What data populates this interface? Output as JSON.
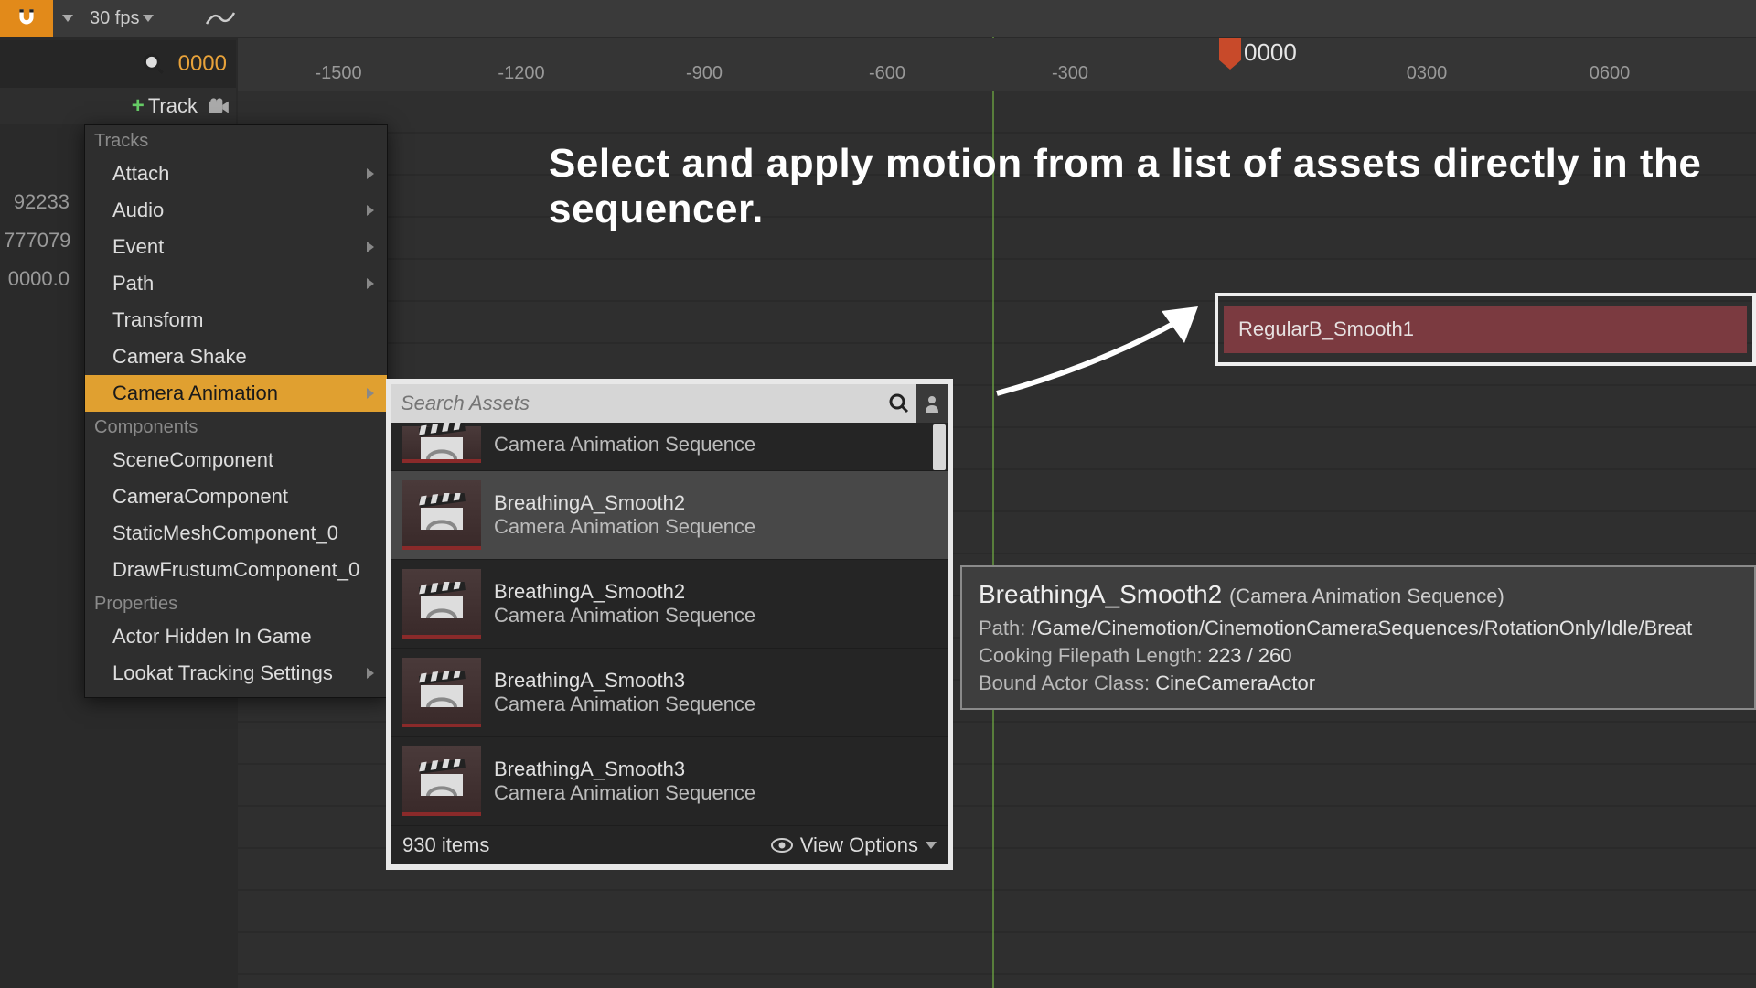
{
  "toolbar": {
    "fps_label": "30 fps"
  },
  "search_row": {
    "frame_label": "0000"
  },
  "track_row": {
    "label": "Track"
  },
  "playhead": {
    "timecode": "0000",
    "ticks": [
      "-1500",
      "-1200",
      "-900",
      "-600",
      "-300",
      "0300",
      "0600"
    ]
  },
  "left_scale": [
    "92233",
    "777079",
    "0000.0"
  ],
  "headline": "Select and apply motion from a list of assets directly in the sequencer.",
  "clip": {
    "name": "RegularB_Smooth1"
  },
  "ctx": {
    "tracks_header": "Tracks",
    "tracks": [
      {
        "label": "Attach",
        "sub": true
      },
      {
        "label": "Audio",
        "sub": true
      },
      {
        "label": "Event",
        "sub": true
      },
      {
        "label": "Path",
        "sub": true
      },
      {
        "label": "Transform",
        "sub": false
      },
      {
        "label": "Camera Shake",
        "sub": false
      },
      {
        "label": "Camera Animation",
        "sub": true,
        "hl": true
      }
    ],
    "components_header": "Components",
    "components": [
      {
        "label": "SceneComponent"
      },
      {
        "label": "CameraComponent"
      },
      {
        "label": "StaticMeshComponent_0"
      },
      {
        "label": "DrawFrustumComponent_0"
      }
    ],
    "properties_header": "Properties",
    "properties": [
      {
        "label": "Actor Hidden In Game",
        "sub": false
      },
      {
        "label": "Lookat Tracking Settings",
        "sub": true
      }
    ]
  },
  "assets": {
    "search_placeholder": "Search Assets",
    "type_label": "Camera Animation Sequence",
    "items": [
      {
        "name": "",
        "first": true
      },
      {
        "name": "BreathingA_Smooth2",
        "hover": true
      },
      {
        "name": "BreathingA_Smooth2"
      },
      {
        "name": "BreathingA_Smooth3"
      },
      {
        "name": "BreathingA_Smooth3"
      }
    ],
    "count": "930 items",
    "view_options": "View Options"
  },
  "tooltip": {
    "title": "BreathingA_Smooth2",
    "subtitle": "(Camera Animation Sequence)",
    "path_label": "Path:",
    "path_value": "/Game/Cinemotion/CinemotionCameraSequences/RotationOnly/Idle/Breat",
    "cook_label": "Cooking Filepath Length:",
    "cook_value": "223 / 260",
    "actor_label": "Bound Actor Class:",
    "actor_value": "CineCameraActor"
  }
}
